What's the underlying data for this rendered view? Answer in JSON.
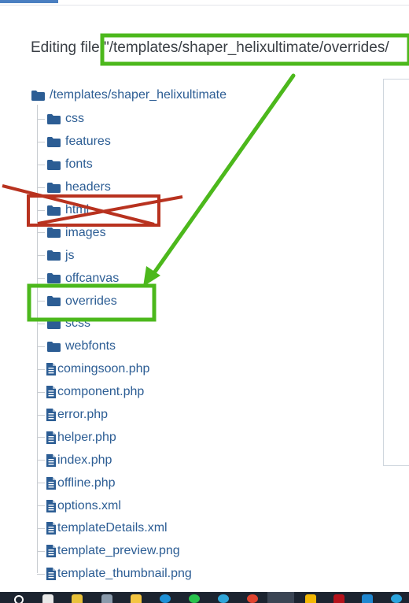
{
  "editing": {
    "prefix": "Editing file ",
    "path": "\"/templates/shaper_helixultimate/overrides/"
  },
  "tree": {
    "root": "/templates/shaper_helixultimate",
    "folders": [
      "css",
      "features",
      "fonts",
      "headers",
      "html",
      "images",
      "js",
      "offcanvas",
      "overrides",
      "scss",
      "webfonts"
    ],
    "files": [
      "comingsoon.php",
      "component.php",
      "error.php",
      "helper.php",
      "index.php",
      "offline.php",
      "options.xml",
      "templateDetails.xml",
      "template_preview.png",
      "template_thumbnail.png"
    ]
  },
  "colors": {
    "link": "#2c5d94",
    "highlight_green": "#4cb81c",
    "cross_red": "#b8321f",
    "taskbar": "#1c2430"
  },
  "icons": {
    "folder": "folder-icon",
    "file": "file-icon"
  }
}
